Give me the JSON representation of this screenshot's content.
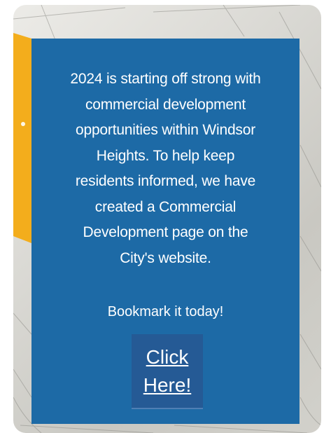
{
  "card": {
    "message": "2024 is starting off strong with\ncommercial development\nopportunities within Windsor\nHeights. To help keep\nresidents informed, we have\ncreated a Commercial\nDevelopment page on the\nCity's website.",
    "bookmark_text": "Bookmark it today!",
    "cta_label": "Click\nHere!"
  },
  "colors": {
    "panel": "#1d6aa6",
    "button": "#255a95",
    "accent_orange": "#f3ad1c",
    "text": "#ffffff"
  }
}
